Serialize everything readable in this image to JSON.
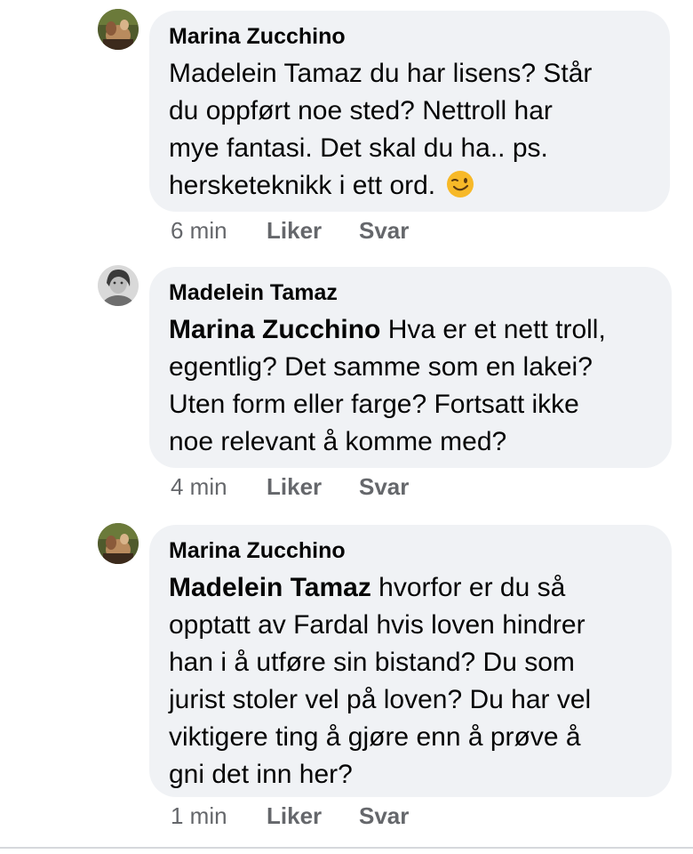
{
  "comments": [
    {
      "author": "Marina Zucchino",
      "mention": "",
      "text_lines": [
        "Madelein Tamaz du har lisens? Står",
        "du oppført noe sted?  Nettroll har",
        "mye fantasi. Det skal du ha.. ps.",
        "hersketeknikk i ett ord."
      ],
      "emoji": "winking-face",
      "time": "6 min",
      "like_label": "Liker",
      "reply_label": "Svar"
    },
    {
      "author": "Madelein Tamaz",
      "mention": "Marina Zucchino",
      "text_lines": [
        " Hva er et nett troll,",
        "egentlig? Det samme som en lakei?",
        "Uten form eller farge? Fortsatt ikke",
        "noe relevant å komme med?"
      ],
      "time": "4 min",
      "like_label": "Liker",
      "reply_label": "Svar"
    },
    {
      "author": "Marina Zucchino",
      "mention": "Madelein Tamaz",
      "text_lines": [
        " hvorfor er du så",
        "opptatt av Fardal hvis loven hindrer",
        "han i å utføre sin bistand? Du som",
        "jurist stoler vel på loven? Du har vel",
        "viktigere ting å gjøre enn å prøve å",
        "gni det inn her?"
      ],
      "time": "1 min",
      "like_label": "Liker",
      "reply_label": "Svar"
    }
  ],
  "colors": {
    "bubble_bg": "#f0f2f5",
    "text": "#050505",
    "meta_text": "#65676b"
  }
}
